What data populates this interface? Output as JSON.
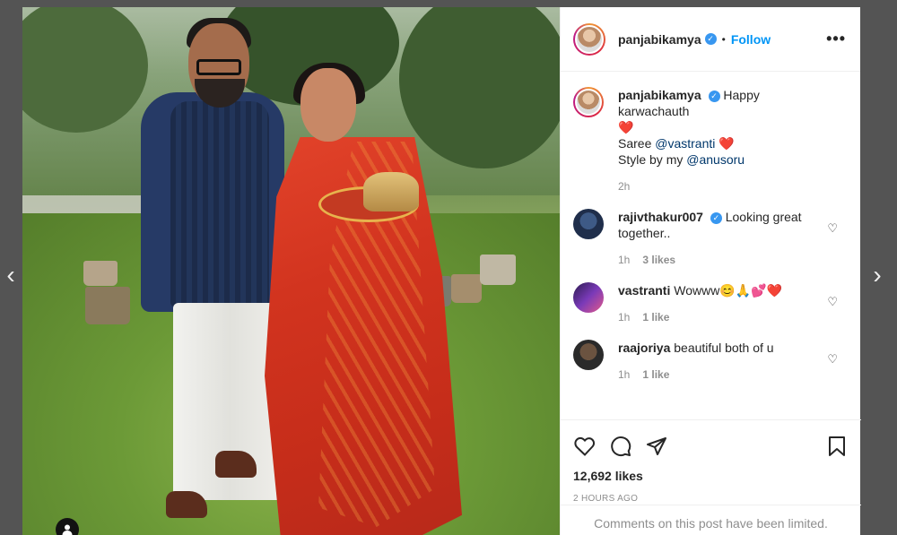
{
  "nav": {
    "prev": "‹",
    "next": "›"
  },
  "header": {
    "username": "panjabikamya",
    "follow_label": "Follow",
    "more": "•••"
  },
  "caption": {
    "username": "panjabikamya",
    "line1": "Happy karwachauth",
    "heart": "❤️",
    "line2_prefix": "Saree",
    "line2_mention": "@vastranti",
    "line2_heart": "❤️",
    "line3_prefix": "Style by my",
    "line3_mention": "@anusoru",
    "time": "2h"
  },
  "comments": [
    {
      "username": "rajivthakur007",
      "text": "Looking great together..",
      "time": "1h",
      "likes": "3 likes",
      "verified": true
    },
    {
      "username": "vastranti",
      "text": "Wowww😊🙏💕❤️",
      "time": "1h",
      "likes": "1 like",
      "verified": false
    },
    {
      "username": "raajoriya",
      "text": "beautiful both of u",
      "time": "1h",
      "likes": "1 like",
      "verified": false
    }
  ],
  "actions": {
    "like_count": "12,692 likes",
    "posted": "2 HOURS AGO",
    "limited_notice": "Comments on this post have been limited."
  },
  "icons": [
    "heart-icon",
    "comment-icon",
    "share-icon",
    "bookmark-icon",
    "tag-user-icon",
    "verified-icon"
  ],
  "colors": {
    "link": "#0095f6",
    "verified": "#3897f0",
    "muted": "#8e8e8e"
  }
}
